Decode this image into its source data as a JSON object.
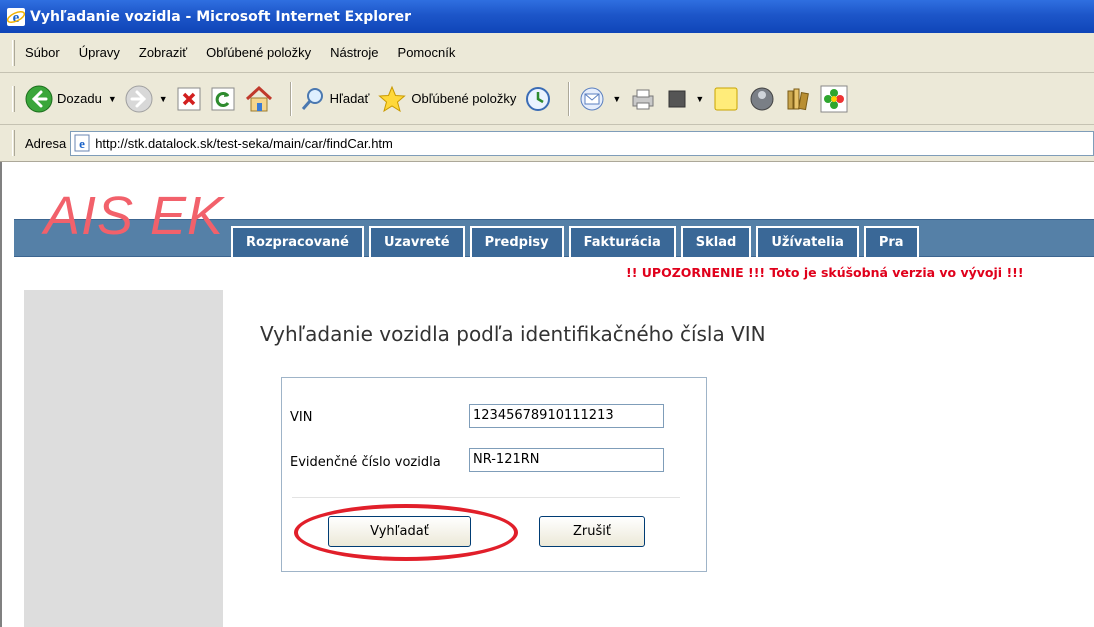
{
  "window": {
    "title": "Vyhľadanie vozidla - Microsoft Internet Explorer",
    "icon": "ie-icon"
  },
  "menu": {
    "items": [
      "Súbor",
      "Úpravy",
      "Zobraziť",
      "Obľúbené položky",
      "Nástroje",
      "Pomocník"
    ]
  },
  "toolbar": {
    "back_label": "Dozadu",
    "search_label": "Hľadať",
    "favorites_label": "Obľúbené položky"
  },
  "address": {
    "label": "Adresa",
    "url": "http://stk.datalock.sk/test-seka/main/car/findCar.htm"
  },
  "app": {
    "logo": "AIS EK",
    "nav": [
      "Rozpracované",
      "Uzavreté",
      "Predpisy",
      "Fakturácia",
      "Sklad",
      "Užívatelia",
      "Pra"
    ],
    "warning": "!! UPOZORNENIE !!! Toto je skúšobná verzia vo vývoji !!!"
  },
  "form": {
    "heading": "Vyhľadanie vozidla podľa identifikačného čísla VIN",
    "vin_label": "VIN",
    "vin_value": "12345678910111213",
    "ecv_label": "Evidenčné číslo vozidla",
    "ecv_value": "NR-121RN",
    "search_button": "Vyhľadať",
    "cancel_button": "Zrušiť"
  },
  "colors": {
    "titlebar": "#1d56c9",
    "chrome": "#ece9d8",
    "nav_band": "#5580a7",
    "nav_tab": "#3a6897",
    "logo": "#f2616b",
    "warning": "#e0001b",
    "highlight": "#e11f2a"
  }
}
